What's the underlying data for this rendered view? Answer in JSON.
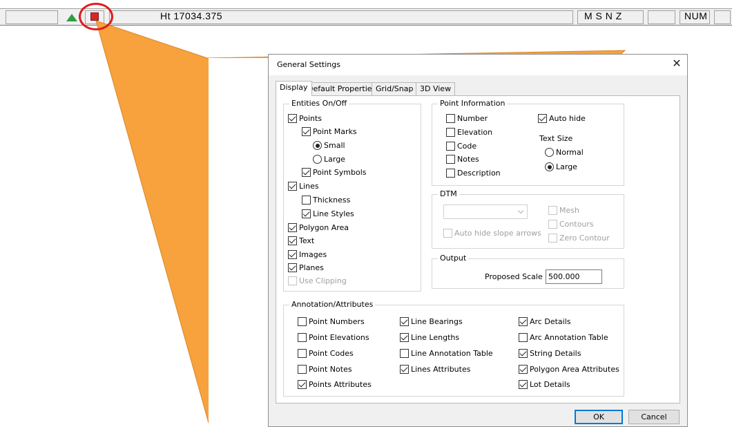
{
  "statusbar": {
    "coords": "Ht 17034.375",
    "modes": "M S N Z",
    "num": "NUM"
  },
  "dialog": {
    "title": "General Settings",
    "tabs": [
      "Display",
      "Default Properties",
      "Grid/Snap",
      "3D View"
    ],
    "entities": {
      "label": "Entities On/Off",
      "points": "Points",
      "point_marks": "Point Marks",
      "small": "Small",
      "large": "Large",
      "point_symbols": "Point Symbols",
      "lines": "Lines",
      "thickness": "Thickness",
      "line_styles": "Line Styles",
      "polygon_area": "Polygon Area",
      "text": "Text",
      "images": "Images",
      "planes": "Planes",
      "use_clipping": "Use Clipping"
    },
    "point_info": {
      "label": "Point Information",
      "number": "Number",
      "elevation": "Elevation",
      "code": "Code",
      "notes": "Notes",
      "description": "Description",
      "auto_hide": "Auto hide",
      "text_size": "Text Size",
      "normal": "Normal",
      "large": "Large"
    },
    "dtm": {
      "label": "DTM",
      "auto_hide_slope": "Auto hide slope arrows",
      "mesh": "Mesh",
      "contours": "Contours",
      "zero_contour": "Zero Contour"
    },
    "output": {
      "label": "Output",
      "scale_label": "Proposed Scale 1:",
      "scale_value": "500.000"
    },
    "annotation": {
      "label": "Annotation/Attributes",
      "point_numbers": "Point Numbers",
      "point_elevations": "Point Elevations",
      "point_codes": "Point Codes",
      "point_notes": "Point Notes",
      "points_attributes": "Points Attributes",
      "line_bearings": "Line Bearings",
      "line_lengths": "Line Lengths",
      "line_annotation_table": "Line Annotation Table",
      "lines_attributes": "Lines Attributes",
      "arc_details": "Arc Details",
      "arc_annotation_table": "Arc Annotation Table",
      "string_details": "String Details",
      "polygon_area_attributes": "Polygon Area Attributes",
      "lot_details": "Lot Details"
    },
    "ok": "OK",
    "cancel": "Cancel",
    "close_glyph": "✕"
  },
  "colors": {
    "callout": "#f7a23c",
    "highlight_ring": "#e01b1b",
    "accent": "#0078d7"
  }
}
